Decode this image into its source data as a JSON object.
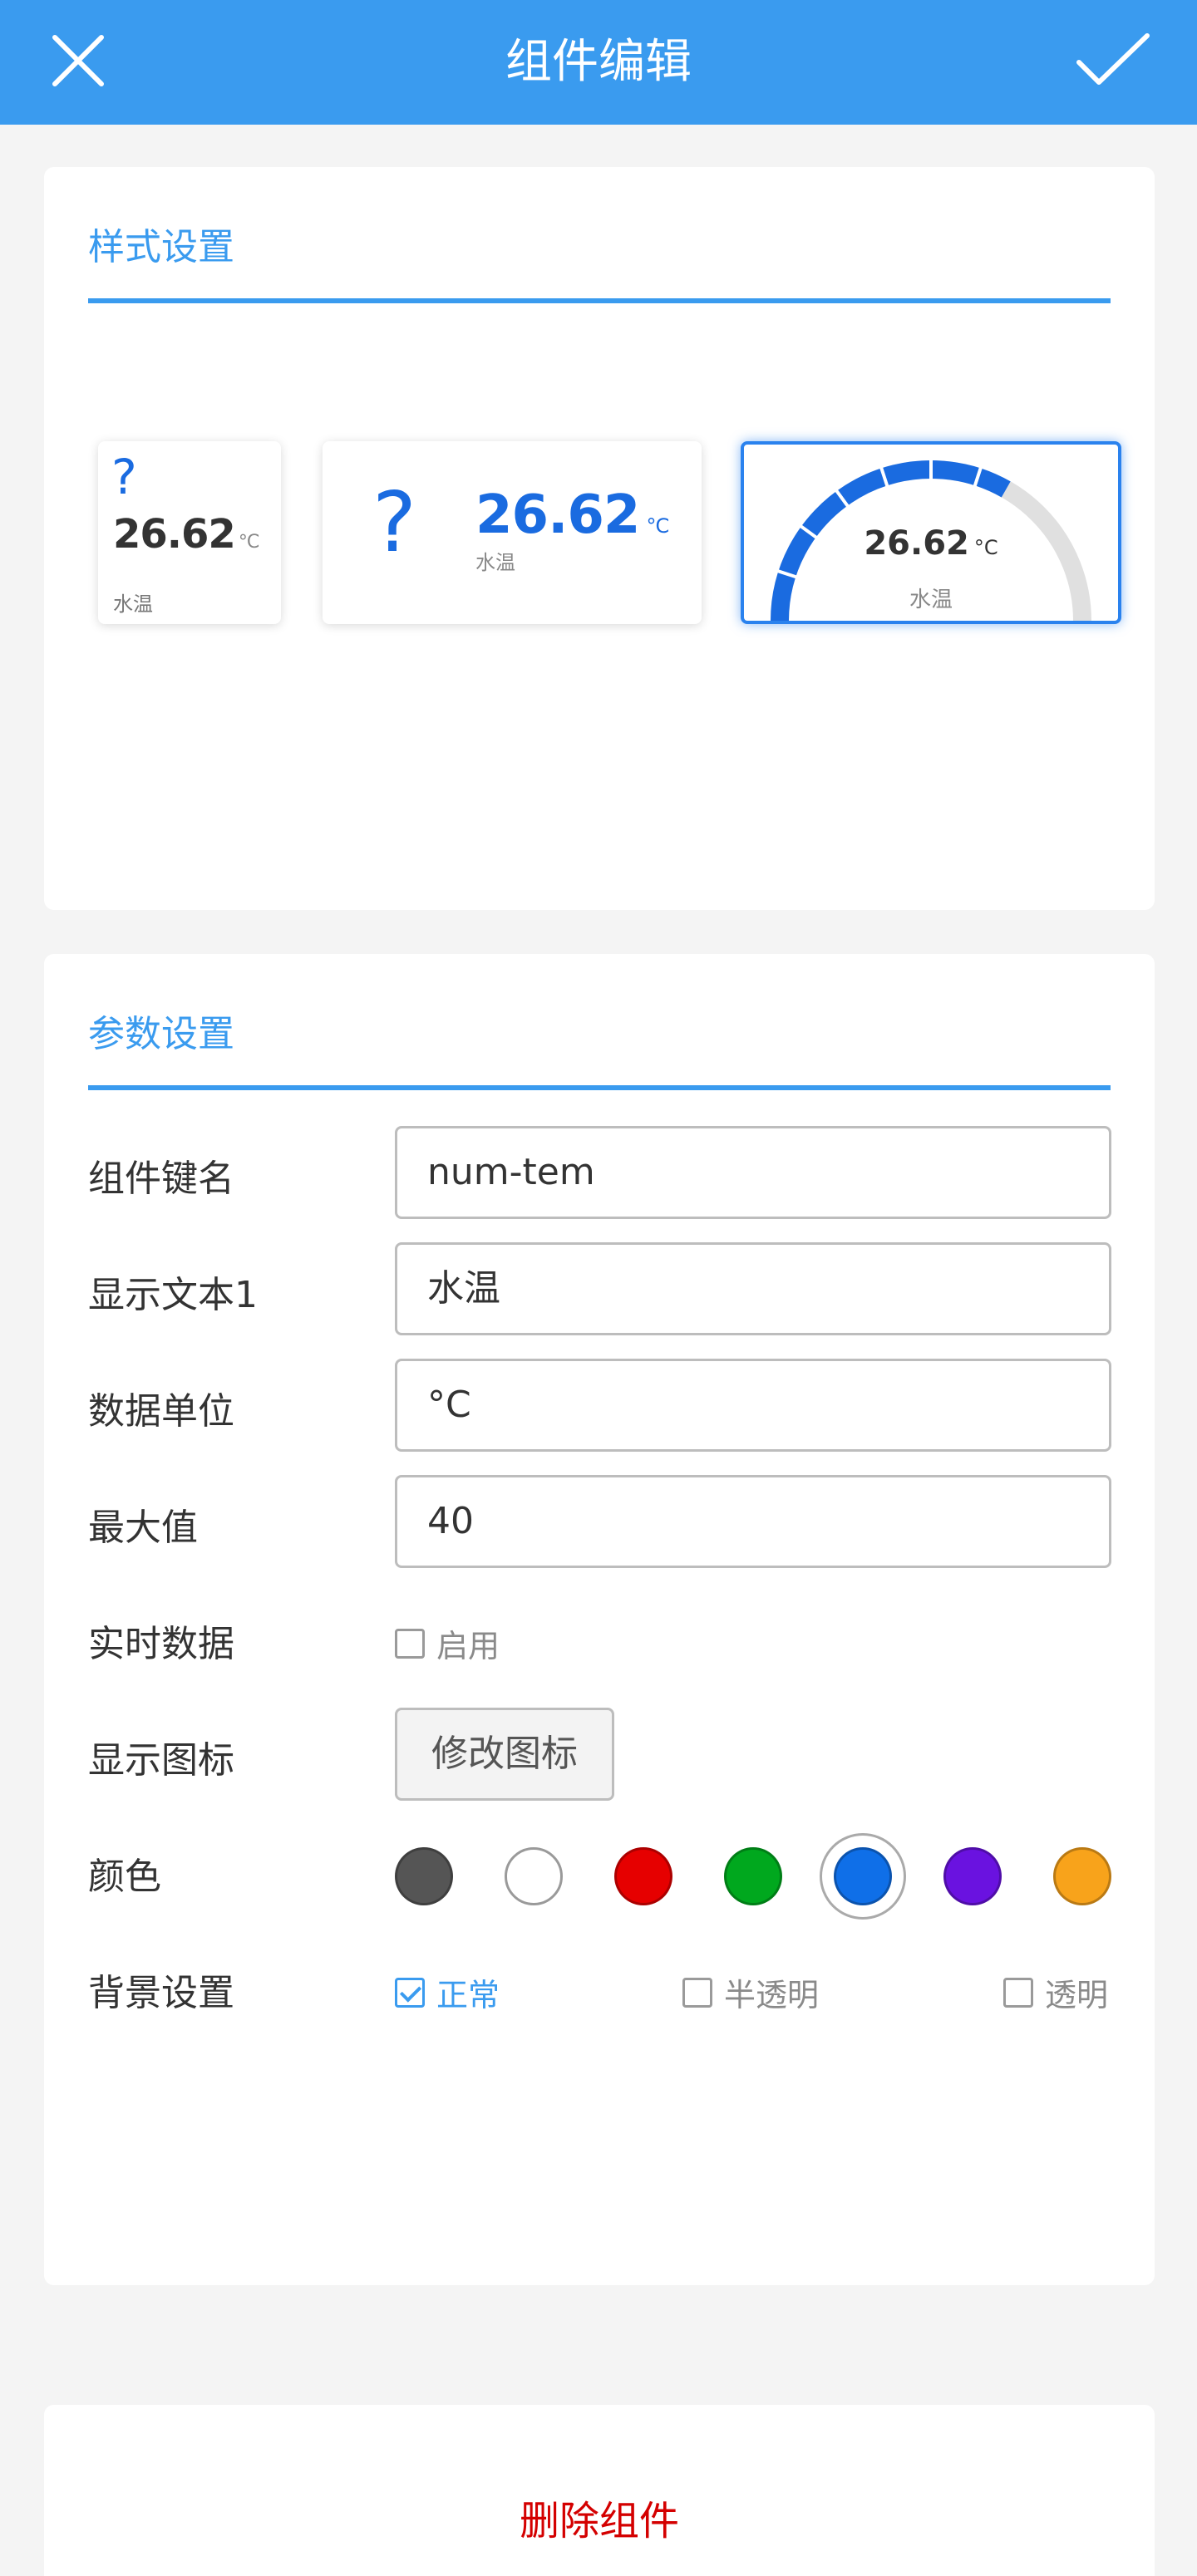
{
  "header": {
    "title": "组件编辑",
    "close_icon": "close-icon",
    "confirm_icon": "check-icon"
  },
  "style_section": {
    "title": "样式设置",
    "previews": [
      {
        "icon": "?",
        "value": "26.62",
        "unit": "°C",
        "label": "水温",
        "selected": false
      },
      {
        "icon": "?",
        "value": "26.62",
        "unit": "°C",
        "label": "水温",
        "selected": false
      },
      {
        "value": "26.62",
        "unit": "°C",
        "label": "水温",
        "selected": true,
        "gauge_fraction": 0.6651
      }
    ]
  },
  "param_section": {
    "title": "参数设置",
    "key_name": {
      "label": "组件键名",
      "value": "num-tem"
    },
    "text1": {
      "label": "显示文本1",
      "value": "水温"
    },
    "unit": {
      "label": "数据单位",
      "value": "°C"
    },
    "max": {
      "label": "最大值",
      "value": "40"
    },
    "realtime": {
      "label": "实时数据",
      "option": "启用",
      "checked": false
    },
    "icon": {
      "label": "显示图标",
      "button": "修改图标"
    },
    "color": {
      "label": "颜色",
      "options": [
        "#555555",
        "#ffffff",
        "#e60000",
        "#00a81e",
        "#0f6fe8",
        "#6a12e0",
        "#f8a31b"
      ],
      "selected": 4
    },
    "background": {
      "label": "背景设置",
      "options": [
        {
          "label": "正常",
          "checked": true
        },
        {
          "label": "半透明",
          "checked": false
        },
        {
          "label": "透明",
          "checked": false
        }
      ]
    }
  },
  "delete_button": "删除组件",
  "colors": {
    "accent": "#3a9bef",
    "gauge_fill": "#1a6be0",
    "gauge_track": "#e0e0e0",
    "danger": "#d40000"
  }
}
